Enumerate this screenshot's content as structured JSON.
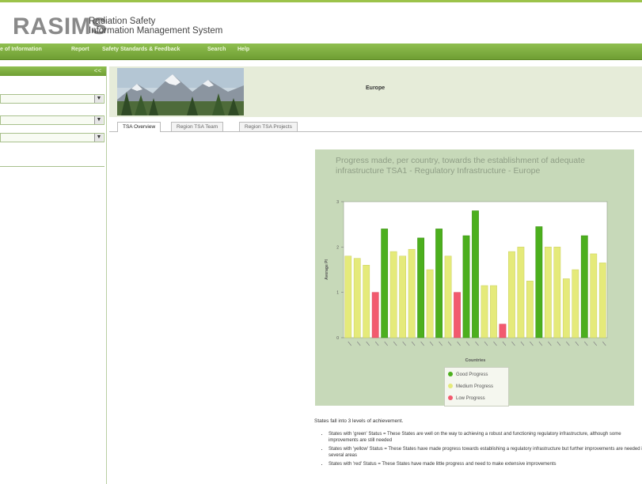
{
  "header": {
    "logo": "RASIMS",
    "subtitle_line1": "Radiation Safety",
    "subtitle_line2": "Information Management System"
  },
  "nav": {
    "items": [
      "e of Information",
      "Report",
      "Safety Standards & Feedback",
      "Search",
      "Help"
    ]
  },
  "sidebar": {
    "collapse_label": "<<"
  },
  "banner": {
    "title": "Europe"
  },
  "tabs": [
    "TSA Overview",
    "Region TSA Team",
    "Region TSA Projects"
  ],
  "chart_data": {
    "type": "bar",
    "title": "Progress made, per country, towards the establishment of adequate infrastructure TSA1 - Regulatory Infrastructure - Europe",
    "ylabel": "Average PI",
    "xlabel": "Countries",
    "ylim": [
      0,
      3
    ],
    "yticks": [
      0,
      1,
      2,
      3
    ],
    "values": [
      1.8,
      1.75,
      1.6,
      1.0,
      2.4,
      1.9,
      1.8,
      1.95,
      2.2,
      1.5,
      2.4,
      1.8,
      1.0,
      2.25,
      2.8,
      1.15,
      1.15,
      0.3,
      1.9,
      2.0,
      1.25,
      2.45,
      2.0,
      2.0,
      1.3,
      1.5,
      2.25,
      1.85,
      1.65
    ],
    "status": [
      "medium",
      "medium",
      "medium",
      "low",
      "good",
      "medium",
      "medium",
      "medium",
      "good",
      "medium",
      "good",
      "medium",
      "low",
      "good",
      "good",
      "medium",
      "medium",
      "low",
      "medium",
      "medium",
      "medium",
      "good",
      "medium",
      "medium",
      "medium",
      "medium",
      "good",
      "medium",
      "medium"
    ],
    "legend": [
      {
        "label": "Good Progress",
        "color": "#4caf1e"
      },
      {
        "label": "Medium Progress",
        "color": "#e5ea7a"
      },
      {
        "label": "Low Progress",
        "color": "#f25a6e"
      }
    ],
    "grid": false
  },
  "body": {
    "intro": "States fall into 3 levels of achievement.",
    "bullets": [
      "States with 'green' Status = These States are well on the way to achieving a robust and functioning regulatory infrastructure, although some improvements are still needed",
      "States with 'yellow' Status = These States have made progress towards establishing a regulatory infrastructure but further improvements are needed in several areas",
      "States with 'red' Status = These States have made little progress and need to make extensive improvements"
    ]
  }
}
